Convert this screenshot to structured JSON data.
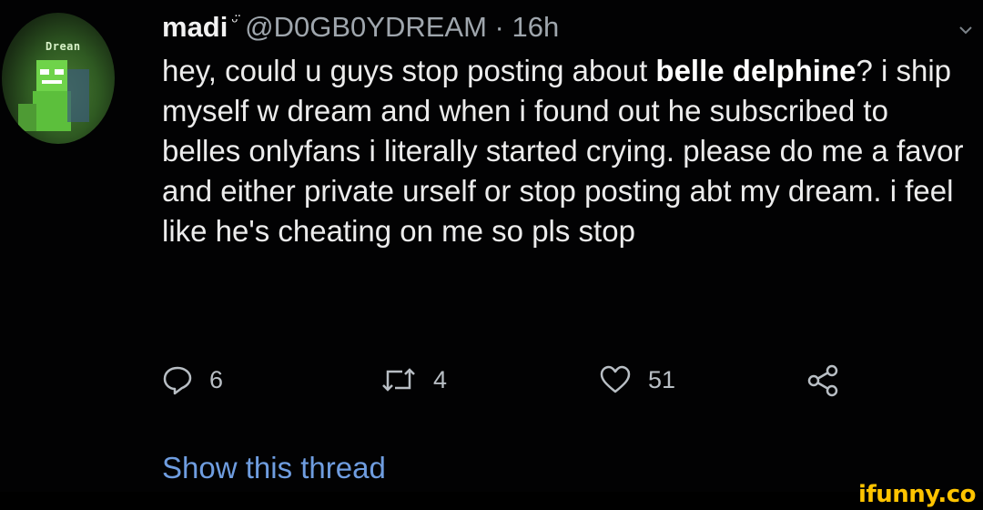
{
  "tweet": {
    "avatar_text": "Drean",
    "display_name": "madi",
    "name_emoji": "ᵕ̈",
    "handle_time": "@D0GB0YDREAM · 16h",
    "body": {
      "part1": "hey, could u guys stop posting about ",
      "bold1": "belle delphine",
      "part2": "? i ship myself w dream and when i found out he subscribed to belles onlyfans i literally started crying. please do me a favor and either private urself or stop posting abt my dream. i feel like he's cheating on me so pls stop"
    },
    "actions": {
      "replies": "6",
      "retweets": "4",
      "likes": "51"
    },
    "show_thread": "Show this thread"
  },
  "watermark": "ifunny.co",
  "colors": {
    "background": "#020203",
    "text": "#ececec",
    "muted": "#9fa6ad",
    "link": "#6f9de0",
    "watermark": "#ffc400"
  }
}
